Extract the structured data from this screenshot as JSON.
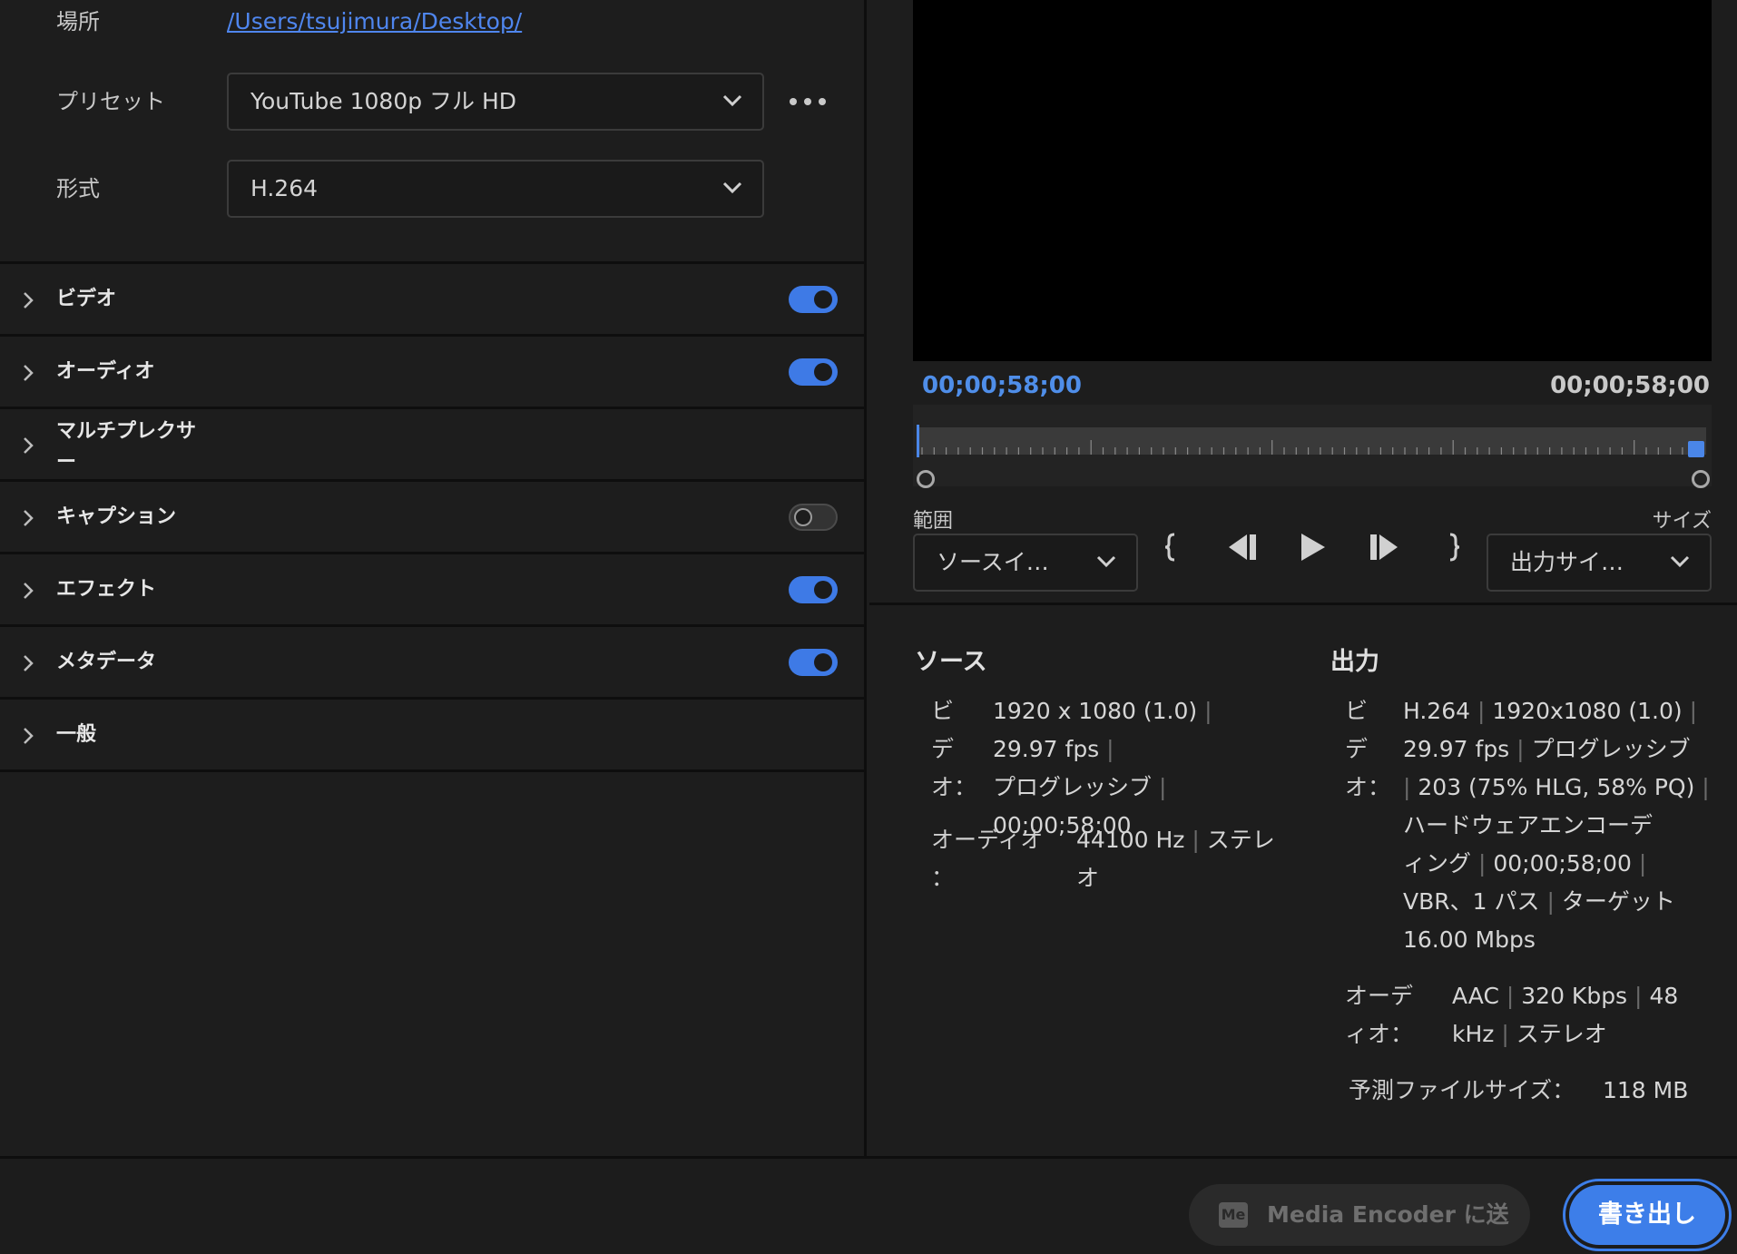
{
  "settings": {
    "location_label": "場所",
    "location_path": "/Users/tsujimura/Desktop/",
    "preset_label": "プリセット",
    "preset_value": "YouTube 1080p フル HD",
    "format_label": "形式",
    "format_value": "H.264"
  },
  "sections": [
    {
      "label": "ビデオ",
      "toggle": "on"
    },
    {
      "label": "オーディオ",
      "toggle": "on"
    },
    {
      "label": "マルチプレクサー",
      "toggle": "none"
    },
    {
      "label": "キャプション",
      "toggle": "off"
    },
    {
      "label": "エフェクト",
      "toggle": "on"
    },
    {
      "label": "メタデータ",
      "toggle": "on"
    },
    {
      "label": "一般",
      "toggle": "none"
    }
  ],
  "preview": {
    "timecode_in": "00;00;58;00",
    "timecode_out": "00;00;58;00",
    "range_label": "範囲",
    "range_value": "ソースイ…",
    "size_label": "サイズ",
    "size_value": "出力サイ…"
  },
  "source": {
    "heading": "ソース",
    "video_label": "ビデオ：",
    "video_line1": "1920 x 1080 (1.0)",
    "video_line1b": "29.97 fps",
    "video_line2": "プログレッシブ",
    "video_line3": "00;00;58;00",
    "audio_label1": "オーディオ",
    "audio_label2": "：",
    "audio_line1a": "44100 Hz",
    "audio_line1b": "ステレ",
    "audio_line2": "オ"
  },
  "output": {
    "heading": "出力",
    "video_label": "ビデオ：",
    "l1a": "H.264",
    "l1b": "1920x1080 (1.0)",
    "l2a": "29.97 fps",
    "l2b": "プログレッシブ",
    "l3": "203 (75% HLG, 58% PQ)",
    "l4": "ハードウェアエンコーデ",
    "l5a": "ィング",
    "l5b": "00;00;58;00",
    "l6a": "VBR、1 パス",
    "l6b": "ターゲット",
    "l7": "16.00 Mbps",
    "audio_label1": "オーデ",
    "audio_label2": "ィオ：",
    "a1a": "AAC",
    "a1b": "320 Kbps",
    "a1c": "48",
    "a2a": "kHz",
    "a2b": "ステレオ",
    "filesize_label": "予測ファイルサイズ：",
    "filesize_value": "118 MB"
  },
  "footer": {
    "media_encoder_badge": "Me",
    "media_encoder_label": "Media Encoder に送信",
    "export_label": "書き出し"
  },
  "colors": {
    "accent": "#3d7ee9",
    "timecode_blue": "#4f8ee9",
    "background": "#1d1d1d"
  }
}
